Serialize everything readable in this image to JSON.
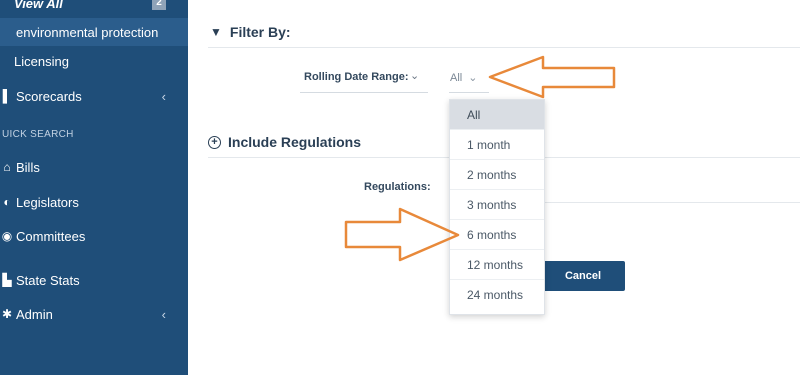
{
  "sidebar": {
    "view_all_label": "View All",
    "view_all_badge": "2",
    "items": [
      {
        "label": "environmental protection"
      },
      {
        "label": "Licensing"
      },
      {
        "label": "Scorecards",
        "chevron": "‹"
      }
    ],
    "quick_search_heading": "UICK SEARCH",
    "search_items": [
      {
        "label": "Bills",
        "icon": "⌂"
      },
      {
        "label": "Legislators",
        "icon": "◐"
      },
      {
        "label": "Committees",
        "icon": "◉"
      }
    ],
    "other_items": [
      {
        "label": "State Stats",
        "icon": "▙"
      },
      {
        "label": "Admin",
        "icon": "✱",
        "chevron": "‹"
      }
    ]
  },
  "filter": {
    "title": "Filter By:",
    "rolling_label": "Rolling Date Range:",
    "rolling_chevron": "⌄",
    "selected_value": "All",
    "select_chevron": "⌄",
    "options": [
      "All",
      "1 month",
      "2 months",
      "3 months",
      "6 months",
      "12 months",
      "24 months"
    ]
  },
  "include": {
    "title": "Include Regulations",
    "regulations_label": "Regulations:"
  },
  "buttons": {
    "cancel": "Cancel"
  },
  "colors": {
    "sidebar_bg": "#1f4e79",
    "arrow_stroke": "#e8893a",
    "selected_option_bg": "#d9dde3"
  }
}
